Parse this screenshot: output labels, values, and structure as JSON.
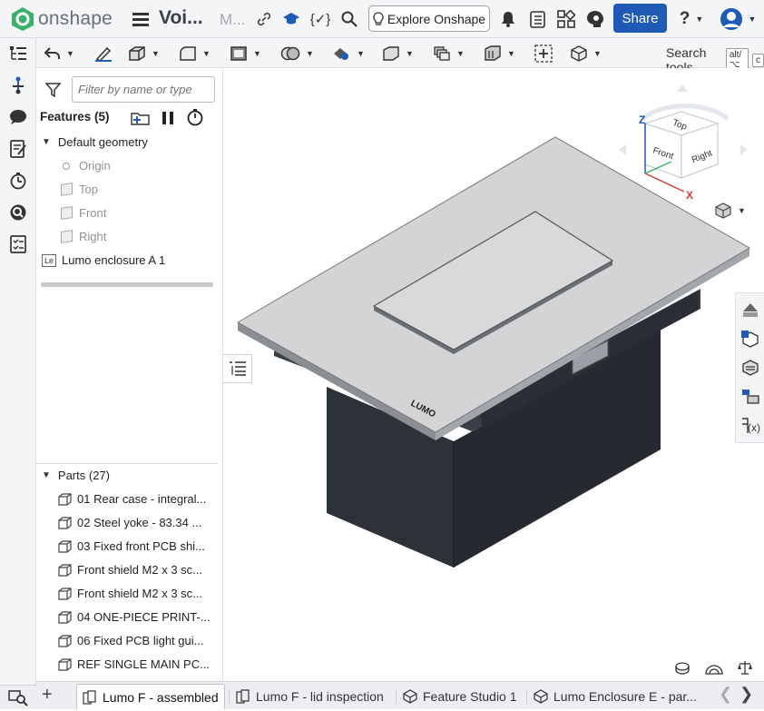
{
  "app": {
    "name": "onshape",
    "doc_title": "Voi...",
    "doc_version": "M..."
  },
  "topbar": {
    "explore_label": "Explore Onshape",
    "share_label": "Share",
    "help_label": "?"
  },
  "toolbar": {
    "search_label": "Search tools...",
    "search_shortcut_1": "alt/⌥",
    "search_shortcut_2": "c"
  },
  "feature_panel": {
    "filter_placeholder": "Filter by name or type",
    "features_header": "Features (5)",
    "default_geometry": "Default geometry",
    "origin": "Origin",
    "planes": [
      "Top",
      "Front",
      "Right"
    ],
    "feature_badge": "Le",
    "feature_item": "Lumo enclosure A 1",
    "parts_header": "Parts (27)",
    "parts": [
      "01 Rear case - integral...",
      "02 Steel yoke - 83.34 ...",
      "03 Fixed front PCB shi...",
      "Front shield M2 x 3 sc...",
      "Front shield M2 x 3 sc...",
      "04 ONE-PIECE PRINT-...",
      "06 Fixed PCB light gui...",
      "REF SINGLE MAIN PC..."
    ]
  },
  "view_cube": {
    "axis_z": "Z",
    "axis_x": "X",
    "face_top": "Top",
    "face_front": "Front",
    "face_right": "Right"
  },
  "model": {
    "logo_text": "LUMO"
  },
  "tabs": [
    {
      "label": "Lumo F - assembled",
      "active": true
    },
    {
      "label": "Lumo F - lid inspection",
      "active": false
    },
    {
      "label": "Feature Studio 1",
      "active": false
    },
    {
      "label": "Lumo Enclosure E - par...",
      "active": false
    }
  ],
  "colors": {
    "share_blue": "#1f5bb5",
    "logo_green": "#3bb06b",
    "lid_gray": "#d3d4d6",
    "body_dark": "#2b3036"
  }
}
